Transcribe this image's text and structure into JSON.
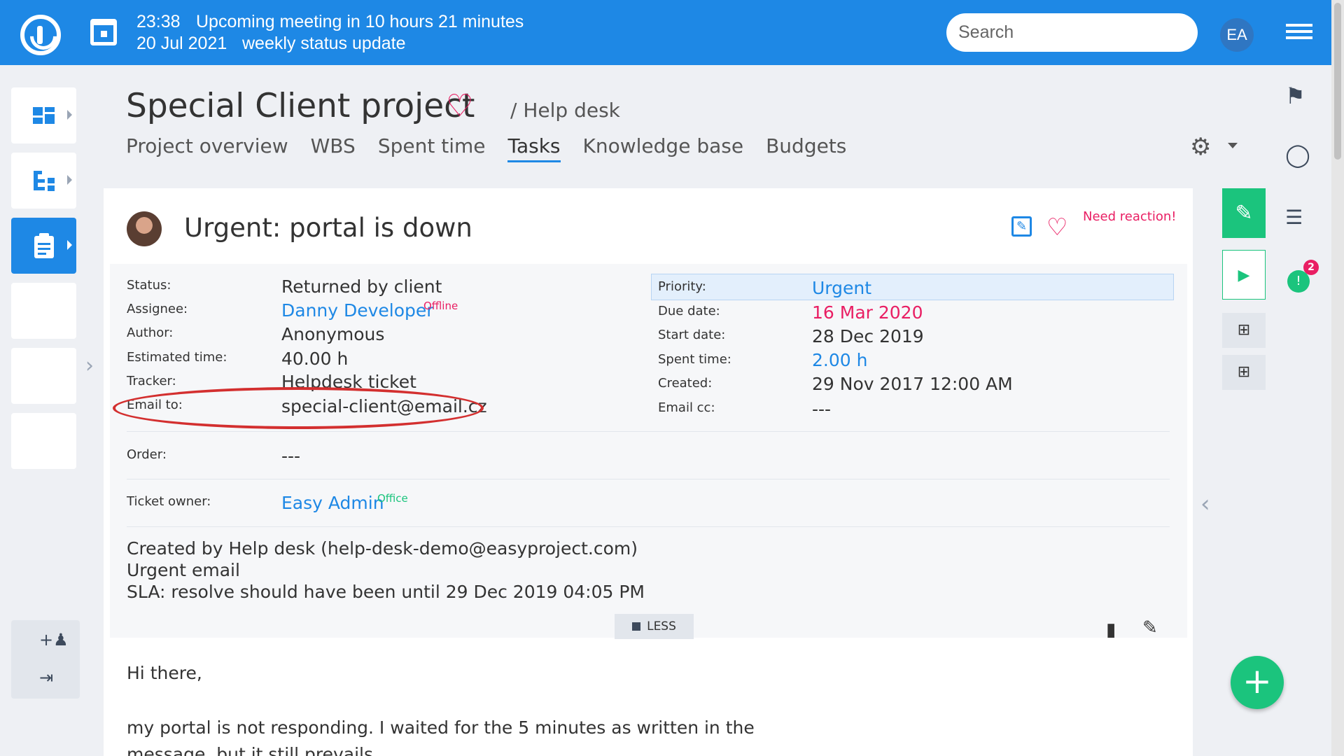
{
  "topbar": {
    "meeting_time": "23:38",
    "meeting_text": "Upcoming meeting in 10 hours 21 minutes",
    "meeting_date": "20 Jul 2021",
    "meeting_title": "weekly status update",
    "search_placeholder": "Search",
    "user_initials": "EA"
  },
  "project": {
    "title": "Special Client project",
    "breadcrumb": "/ Help desk",
    "tabs": [
      "Project overview",
      "WBS",
      "Spent time",
      "Tasks",
      "Knowledge base",
      "Budgets"
    ],
    "active_tab": "Tasks"
  },
  "task": {
    "title": "Urgent: portal is down",
    "need_reaction": "Need reaction!",
    "left": [
      {
        "label": "Status:",
        "value": "Returned by client"
      },
      {
        "label": "Assignee:",
        "value": "Danny Developer",
        "status": "Offline"
      },
      {
        "label": "Author:",
        "value": "Anonymous"
      },
      {
        "label": "Estimated time:",
        "value": "40.00 h"
      },
      {
        "label": "Tracker:",
        "value": "Helpdesk ticket"
      },
      {
        "label": "Email to:",
        "value": "special-client@email.cz"
      },
      {
        "label": "Order:",
        "value": "---"
      },
      {
        "label": "Ticket owner:",
        "value": "Easy Admin",
        "status": "Office"
      }
    ],
    "right": [
      {
        "label": "Priority:",
        "value": "Urgent"
      },
      {
        "label": "Due date:",
        "value": "16 Mar 2020"
      },
      {
        "label": "Start date:",
        "value": "28 Dec 2019"
      },
      {
        "label": "Spent time:",
        "value": "2.00 h"
      },
      {
        "label": "Created:",
        "value": "29 Nov 2017 12:00 AM"
      },
      {
        "label": "Email cc:",
        "value": "---"
      }
    ],
    "description": [
      "Created by Help desk (help-desk-demo@easyproject.com)",
      "Urgent email",
      "SLA: resolve should have been until 29 Dec 2019 04:05 PM"
    ],
    "less_label": "LESS",
    "body_lines": [
      "Hi there,",
      "my portal is not responding. I waited for the 5 minutes as written in the",
      "message, but it still prevails."
    ]
  },
  "sidebar": {
    "timer_badge": "2"
  },
  "colors": {
    "topbar": "#1e88e5",
    "accent_green": "#1bc47d",
    "accent_pink": "#e91e63",
    "link_blue": "#1e88e5",
    "highlight_red": "#d32f2f"
  },
  "icons": [
    "logo-icon",
    "calendar-icon",
    "hamburger-icon",
    "dashboard-icon",
    "tree-icon",
    "clipboard-icon",
    "add-user-icon",
    "logout-icon",
    "heart-icon",
    "gear-icon",
    "flag-icon",
    "bulb-icon",
    "checklist-icon",
    "timer-icon",
    "edit-icon",
    "play-icon",
    "plus-icon",
    "comment-icon",
    "pencil-icon"
  ]
}
